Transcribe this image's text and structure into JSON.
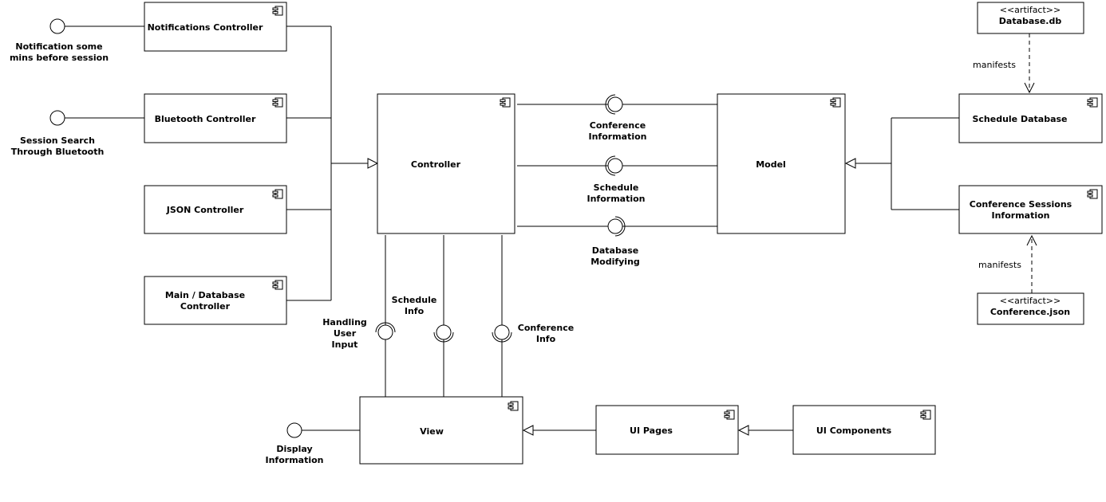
{
  "components": {
    "notifications_controller": "Notifications Controller",
    "bluetooth_controller": "Bluetooth Controller",
    "json_controller": "JSON Controller",
    "main_db_controller_1": "Main / Database",
    "main_db_controller_2": "Controller",
    "controller": "Controller",
    "model": "Model",
    "schedule_database": "Schedule Database",
    "conference_sessions_1": "Conference Sessions",
    "conference_sessions_2": "Information",
    "view": "View",
    "ui_pages": "UI Pages",
    "ui_components": "UI Components"
  },
  "artifacts": {
    "stereotype": "<<artifact>>",
    "database_db": "Database.db",
    "conference_json": "Conference.json",
    "manifests": "manifests"
  },
  "interfaces": {
    "notification_1": "Notification some",
    "notification_2": "mins before session",
    "session_search_1": "Session Search",
    "session_search_2": "Through Bluetooth",
    "conference_information_1": "Conference",
    "conference_information_2": "Information",
    "schedule_information_1": "Schedule",
    "schedule_information_2": "Information",
    "database_modifying_1": "Database",
    "database_modifying_2": "Modifying",
    "handling_user_input_1": "Handling",
    "handling_user_input_2": "User",
    "handling_user_input_3": "Input",
    "schedule_info_1": "Schedule",
    "schedule_info_2": "Info",
    "conference_info_1": "Conference",
    "conference_info_2": "Info",
    "display_information_1": "Display",
    "display_information_2": "Information"
  }
}
